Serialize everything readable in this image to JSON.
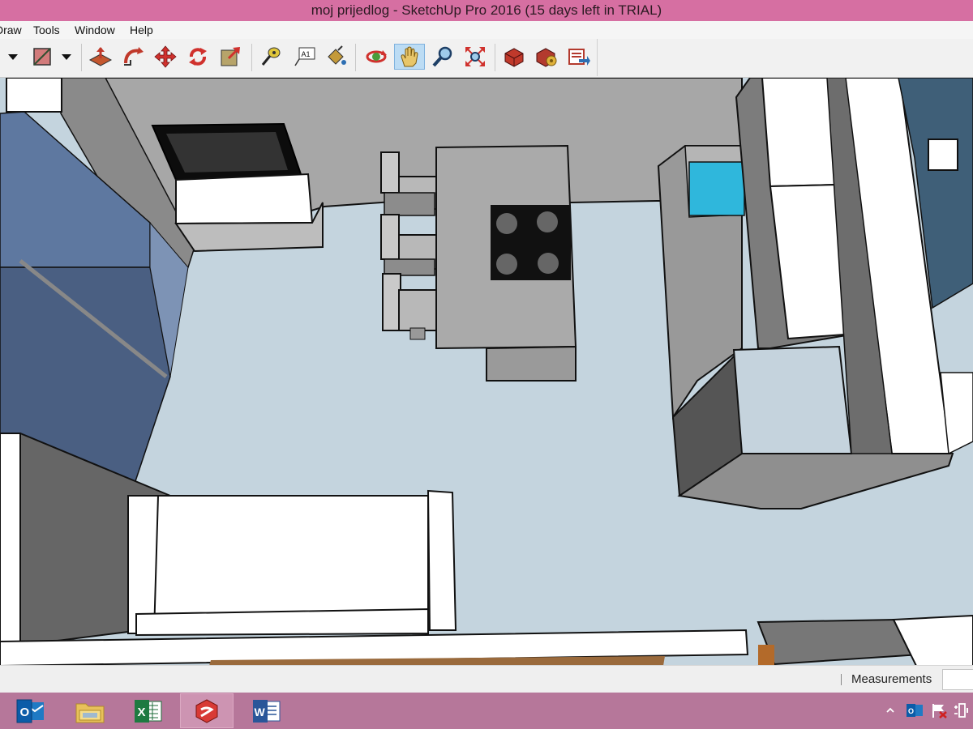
{
  "window": {
    "title": "moj prijedlog - SketchUp Pro 2016 (15 days left in TRIAL)"
  },
  "menu": {
    "items": [
      "Draw",
      "Tools",
      "Window",
      "Help"
    ]
  },
  "toolbar": {
    "active_tool": "pan-icon",
    "tools": [
      "line-dropdown",
      "rectangle-icon",
      "rectangle-dropdown",
      "push-pull-icon",
      "follow-me-icon",
      "move-icon",
      "rotate-icon",
      "scale-icon",
      "tape-measure-icon",
      "text-icon",
      "paint-bucket-icon",
      "orbit-icon",
      "pan-icon",
      "zoom-icon",
      "zoom-extents-icon",
      "3d-warehouse-icon",
      "extension-warehouse-icon",
      "send-to-layout-icon"
    ],
    "text_tool_glyph": "A1"
  },
  "status": {
    "measurements_label": "Measurements",
    "measurements_value": ""
  },
  "taskbar": {
    "apps": [
      "outlook-icon",
      "file-explorer-icon",
      "excel-icon",
      "sketchup-icon",
      "word-icon"
    ],
    "active_app": "sketchup-icon",
    "tray": [
      "tray-overflow-icon",
      "tray-outlook-icon",
      "tray-flag-icon",
      "tray-power-icon"
    ]
  },
  "colors": {
    "title_bar": "#d66fa2",
    "taskbar": "#b6779a",
    "floor": "#c4d4de",
    "wall": "#a6a6a6",
    "blue_cabinets": "#4f6688",
    "sink": "#2fb7dc",
    "active_tool_highlight": "#bcdcf4"
  }
}
